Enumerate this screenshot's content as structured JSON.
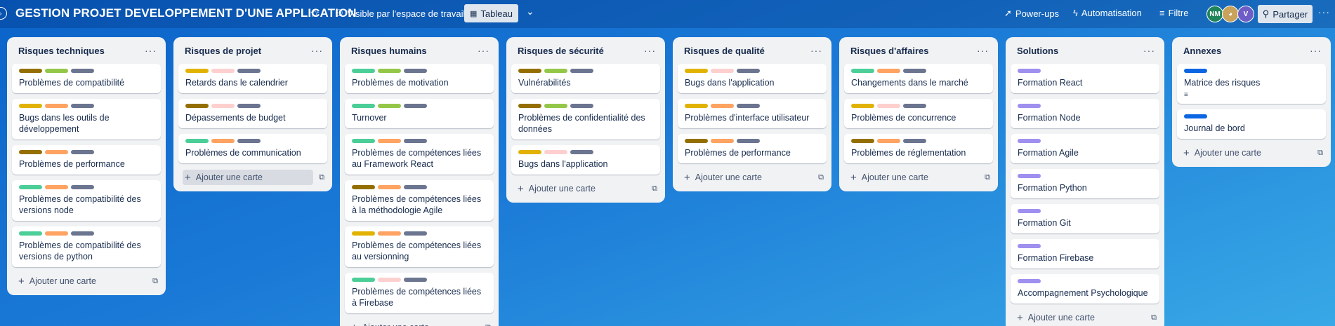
{
  "header": {
    "title": "GESTION PROJET DEVELOPPEMENT D'UNE APPLICATION",
    "visibility": "Visible par l'espace de travail",
    "view": "Tableau",
    "powerups": "Power-ups",
    "automation": "Automatisation",
    "filter": "Filtre",
    "avatars": [
      "NM",
      "",
      "V"
    ],
    "share": "Partager"
  },
  "colors": {
    "brown": "#946f00",
    "lime": "#94c748",
    "gray": "#6b7590",
    "yellow": "#e2b203",
    "pink": "#fdd0cf",
    "green": "#4bce97",
    "orange": "#fea362",
    "purple": "#9f8fef",
    "blue": "#0c66e4"
  },
  "add_card": "Ajouter une carte",
  "lists": [
    {
      "title": "Risques techniques",
      "cards": [
        {
          "title": "Problèmes de compatibilité",
          "labels": [
            "brown",
            "lime",
            "gray"
          ]
        },
        {
          "title": "Bugs dans les outils de développement",
          "labels": [
            "yellow",
            "orange",
            "gray"
          ]
        },
        {
          "title": "Problèmes de performance",
          "labels": [
            "brown",
            "orange",
            "gray"
          ]
        },
        {
          "title": "Problèmes de compatibilité des versions node",
          "labels": [
            "green",
            "orange",
            "gray"
          ]
        },
        {
          "title": "Problèmes de compatibilité des versions de python",
          "labels": [
            "green",
            "orange",
            "gray"
          ]
        }
      ]
    },
    {
      "title": "Risques de projet",
      "cards": [
        {
          "title": "Retards dans le calendrier",
          "labels": [
            "yellow",
            "pink",
            "gray"
          ]
        },
        {
          "title": "Dépassements de budget",
          "labels": [
            "brown",
            "pink",
            "gray"
          ]
        },
        {
          "title": "Problèmes de communication",
          "labels": [
            "green",
            "orange",
            "gray"
          ]
        }
      ]
    },
    {
      "title": "Risques humains",
      "cards": [
        {
          "title": "Problèmes de motivation",
          "labels": [
            "green",
            "lime",
            "gray"
          ]
        },
        {
          "title": "Turnover",
          "labels": [
            "green",
            "lime",
            "gray"
          ]
        },
        {
          "title": "Problèmes de compétences liées au Framework React",
          "labels": [
            "green",
            "orange",
            "gray"
          ]
        },
        {
          "title": "Problèmes de compétences liées à la méthodologie Agile",
          "labels": [
            "brown",
            "orange",
            "gray"
          ]
        },
        {
          "title": "Problèmes de compétences liées au versionning",
          "labels": [
            "yellow",
            "orange",
            "gray"
          ]
        },
        {
          "title": "Problèmes de compétences liées à Firebase",
          "labels": [
            "green",
            "pink",
            "gray"
          ]
        }
      ]
    },
    {
      "title": "Risques de sécurité",
      "cards": [
        {
          "title": "Vulnérabilités",
          "labels": [
            "brown",
            "lime",
            "gray"
          ]
        },
        {
          "title": "Problèmes de confidentialité des données",
          "labels": [
            "brown",
            "lime",
            "gray"
          ]
        },
        {
          "title": "Bugs dans l'application",
          "labels": [
            "yellow",
            "pink",
            "gray"
          ]
        }
      ]
    },
    {
      "title": "Risques de qualité",
      "cards": [
        {
          "title": "Bugs dans l'application",
          "labels": [
            "yellow",
            "pink",
            "gray"
          ]
        },
        {
          "title": "Problèmes d'interface utilisateur",
          "labels": [
            "yellow",
            "orange",
            "gray"
          ]
        },
        {
          "title": "Problèmes de performance",
          "labels": [
            "brown",
            "orange",
            "gray"
          ]
        }
      ]
    },
    {
      "title": "Risques d'affaires",
      "cards": [
        {
          "title": "Changements dans le marché",
          "labels": [
            "green",
            "orange",
            "gray"
          ]
        },
        {
          "title": "Problèmes de concurrence",
          "labels": [
            "yellow",
            "pink",
            "gray"
          ]
        },
        {
          "title": "Problèmes de réglementation",
          "labels": [
            "brown",
            "orange",
            "gray"
          ]
        }
      ]
    },
    {
      "title": "Solutions",
      "cards": [
        {
          "title": "Formation React",
          "labels": [
            "purple"
          ]
        },
        {
          "title": "Formation Node",
          "labels": [
            "purple"
          ]
        },
        {
          "title": "Formation Agile",
          "labels": [
            "purple"
          ]
        },
        {
          "title": "Formation Python",
          "labels": [
            "purple"
          ]
        },
        {
          "title": "Formation Git",
          "labels": [
            "purple"
          ]
        },
        {
          "title": "Formation Firebase",
          "labels": [
            "purple"
          ]
        },
        {
          "title": "Accompagnement Psychologique",
          "labels": [
            "purple"
          ]
        }
      ]
    },
    {
      "title": "Annexes",
      "cards": [
        {
          "title": "Matrice des risques",
          "labels": [
            "blue"
          ],
          "has_description": true
        },
        {
          "title": "Journal de bord",
          "labels": [
            "blue"
          ]
        }
      ]
    }
  ]
}
